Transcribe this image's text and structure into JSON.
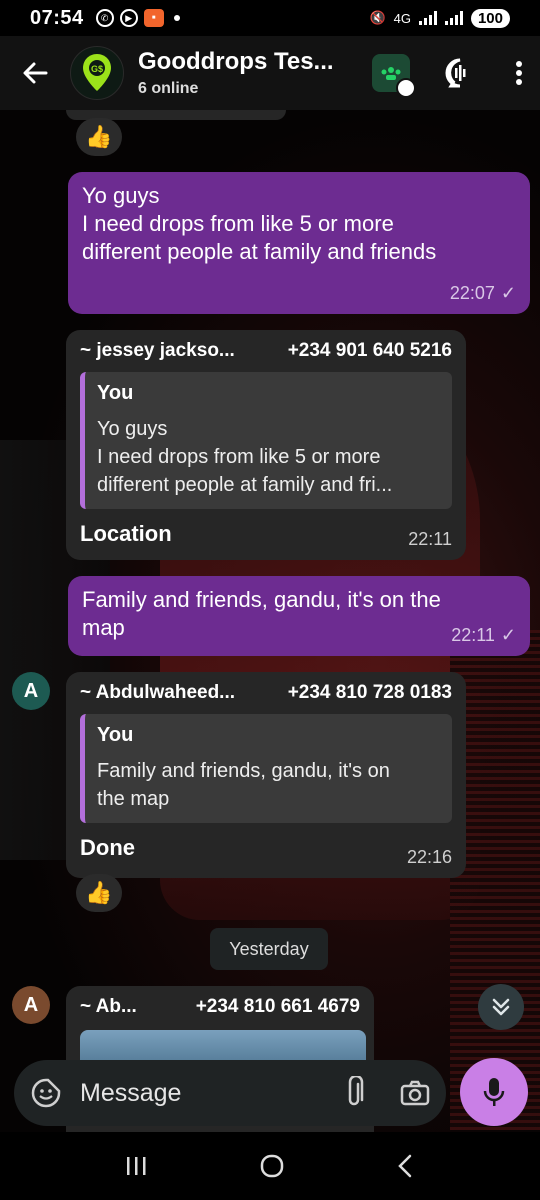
{
  "status_bar": {
    "time": "07:54",
    "network": "4G",
    "battery": "100"
  },
  "header": {
    "title": "Gooddrops Tes...",
    "subtitle": "6 online",
    "avatar_text": "G$"
  },
  "messages": {
    "reaction_top": "👍",
    "m1": {
      "lines": [
        "Yo guys",
        "I need drops from like 5 or more",
        "different people at family and friends"
      ],
      "time": "22:07"
    },
    "m2": {
      "sender": "~ jessey jackso...",
      "phone": "+234 901 640 5216",
      "quote_name": "You",
      "quote_lines": [
        "Yo guys",
        "I need drops from like 5 or more",
        "different people at family and fri..."
      ],
      "reply": "Location",
      "time": "22:11"
    },
    "m3": {
      "lines": [
        "Family and friends, gandu, it's on the",
        "map"
      ],
      "time": "22:11"
    },
    "m4": {
      "avatar": "A",
      "sender": "~ Abdulwaheed...",
      "phone": "+234 810 728 0183",
      "quote_name": "You",
      "quote_lines": [
        "Family and friends, gandu, it's on",
        "the map"
      ],
      "reply": "Done",
      "time": "22:16"
    },
    "reaction_mid": "👍",
    "date_chip": "Yesterday",
    "m5": {
      "avatar": "A",
      "sender": "~ Ab...",
      "phone": "+234 810 661 4679"
    }
  },
  "composer": {
    "placeholder": "Message"
  },
  "colors": {
    "outgoing": "#6d2c91",
    "incoming": "#262626",
    "mic": "#c97fe6",
    "quote_bar": "#b36fdb"
  }
}
